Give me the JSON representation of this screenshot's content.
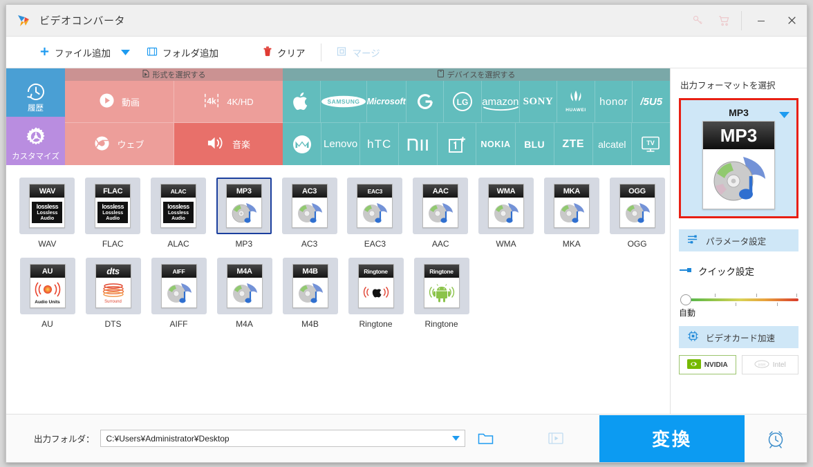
{
  "window": {
    "title": "ビデオコンバータ",
    "logo_icon": "app-logo-icon",
    "key_icon": "key-icon",
    "cart_icon": "cart-icon",
    "minimize_label": "−",
    "close_label": "✕"
  },
  "toolbar": {
    "add_file": "ファイル追加",
    "add_folder": "フォルダ追加",
    "clear": "クリア",
    "merge": "マージ"
  },
  "sidebar": {
    "items": [
      {
        "label": "履歴",
        "icon": "history-clock-icon",
        "color": "#4a9fd4"
      },
      {
        "label": "カスタマイズ",
        "icon": "gear-icon",
        "color": "#b98de0"
      }
    ]
  },
  "tabs": {
    "format": {
      "label": "形式を選択する",
      "icon": "file-icon"
    },
    "device": {
      "label": "デバイスを選択する",
      "icon": "device-icon"
    }
  },
  "category_tiles": [
    {
      "label": "動画",
      "icon": "play-circle-icon",
      "active": false
    },
    {
      "label": "4K/HD",
      "icon": "4k-icon",
      "active": false
    },
    {
      "label": "ウェブ",
      "icon": "chrome-icon",
      "active": false
    },
    {
      "label": "音楽",
      "icon": "speaker-icon",
      "active": true
    }
  ],
  "device_tiles": [
    {
      "name": "apple",
      "label": ""
    },
    {
      "name": "samsung",
      "label": "SAMSUNG"
    },
    {
      "name": "microsoft",
      "label": "Microsoft"
    },
    {
      "name": "google",
      "label": "G"
    },
    {
      "name": "lg",
      "label": "LG"
    },
    {
      "name": "amazon",
      "label": "amazon"
    },
    {
      "name": "sony",
      "label": "SONY"
    },
    {
      "name": "huawei",
      "label": "HUAWEI"
    },
    {
      "name": "honor",
      "label": "honor"
    },
    {
      "name": "asus",
      "label": "/5U5"
    },
    {
      "name": "motorola",
      "label": ""
    },
    {
      "name": "lenovo",
      "label": "Lenovo"
    },
    {
      "name": "htc",
      "label": "hTC"
    },
    {
      "name": "xiaomi",
      "label": "MI"
    },
    {
      "name": "oneplus",
      "label": "1+"
    },
    {
      "name": "nokia",
      "label": "NOKIA"
    },
    {
      "name": "blu",
      "label": "BLU"
    },
    {
      "name": "zte",
      "label": "ZTE"
    },
    {
      "name": "alcatel",
      "label": "alcatel"
    },
    {
      "name": "tv",
      "label": "TV"
    }
  ],
  "format_cards": [
    {
      "label": "WAV",
      "badge": "WAV",
      "art": "lossless",
      "selected": false
    },
    {
      "label": "FLAC",
      "badge": "FLAC",
      "art": "lossless",
      "selected": false
    },
    {
      "label": "ALAC",
      "badge": "ALAC",
      "art": "lossless",
      "selected": false
    },
    {
      "label": "MP3",
      "badge": "MP3",
      "art": "disc",
      "selected": true
    },
    {
      "label": "AC3",
      "badge": "AC3",
      "art": "disc",
      "selected": false
    },
    {
      "label": "EAC3",
      "badge": "EAC3",
      "art": "disc",
      "selected": false
    },
    {
      "label": "AAC",
      "badge": "AAC",
      "art": "disc",
      "selected": false
    },
    {
      "label": "WMA",
      "badge": "WMA",
      "art": "disc",
      "selected": false
    },
    {
      "label": "MKA",
      "badge": "MKA",
      "art": "disc",
      "selected": false
    },
    {
      "label": "OGG",
      "badge": "OGG",
      "art": "disc",
      "selected": false
    },
    {
      "label": "AU",
      "badge": "AU",
      "art": "audiounits",
      "selected": false
    },
    {
      "label": "DTS",
      "badge": "dts",
      "art": "dts",
      "selected": false
    },
    {
      "label": "AIFF",
      "badge": "AIFF",
      "art": "disc",
      "selected": false
    },
    {
      "label": "M4A",
      "badge": "M4A",
      "art": "disc",
      "selected": false
    },
    {
      "label": "M4B",
      "badge": "M4B",
      "art": "disc",
      "selected": false
    },
    {
      "label": "Ringtone",
      "badge": "Ringtone",
      "art": "ring-apple",
      "selected": false
    },
    {
      "label": "Ringtone",
      "badge": "Ringtone",
      "art": "ring-android",
      "selected": false
    }
  ],
  "lossless_text": {
    "word": "lossless",
    "line1": "Lossless",
    "line2": "Audio"
  },
  "audio_units_text": "Audio Units",
  "dts_text": "Surround",
  "right_panel": {
    "title": "出力フォーマットを選択",
    "selected_format": "MP3",
    "caret_icon": "chevron-down-icon",
    "param_button": {
      "label": "パラメータ設定",
      "icon": "sliders-icon"
    },
    "quick_button": {
      "label": "クイック設定",
      "icon": "quick-icon"
    },
    "slider_label": "自動",
    "gpu_button": {
      "label": "ビデオカード加速",
      "icon": "chip-icon"
    },
    "badges": [
      {
        "label": "NVIDIA",
        "state": "on",
        "icon": "nvidia-icon"
      },
      {
        "label": "Intel",
        "state": "off",
        "icon": "intel-icon"
      }
    ],
    "border_color": "#e81f13"
  },
  "bottom": {
    "output_label": "出力フォルダ：",
    "output_path": "C:¥Users¥Administrator¥Desktop",
    "output_placeholder": "C:¥Users¥Administrator¥Desktop",
    "folder_icon": "folder-open-icon",
    "preview_icon": "film-preview-icon",
    "convert_label": "変換",
    "alarm_icon": "alarm-clock-icon",
    "convert_color": "#0c9bf2"
  }
}
